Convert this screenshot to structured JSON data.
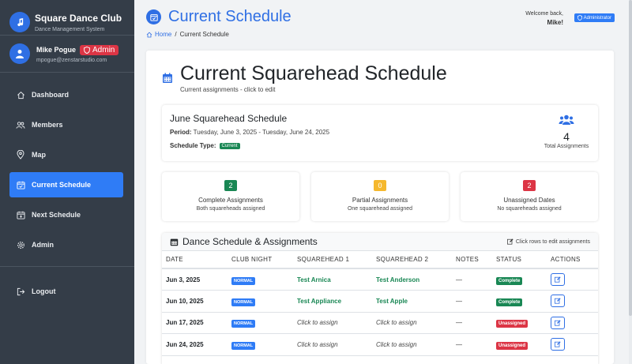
{
  "app": {
    "title": "Square Dance Club",
    "subtitle": "Dance Management System"
  },
  "user": {
    "name": "Mike Pogue",
    "badge": "Admin",
    "email": "mpogue@zenstarstudio.com"
  },
  "nav": {
    "dashboard": "Dashboard",
    "members": "Members",
    "map": "Map",
    "current_schedule": "Current Schedule",
    "next_schedule": "Next Schedule",
    "admin": "Admin",
    "logout": "Logout"
  },
  "header": {
    "title": "Current Schedule",
    "breadcrumb_home": "Home",
    "breadcrumb_sep": "/",
    "breadcrumb_current": "Current Schedule",
    "welcome": "Welcome back,",
    "welcome_name": "Mike!",
    "role": "Administrator"
  },
  "main": {
    "title": "Current Squarehead Schedule",
    "subtitle": "Current assignments - click to edit"
  },
  "schedule": {
    "name": "June Squarehead Schedule",
    "period_label": "Period:",
    "period_value": "Tuesday, June 3, 2025 - Tuesday, June 24, 2025",
    "type_label": "Schedule Type:",
    "type_value": "Current",
    "total_count": "4",
    "total_label": "Total Assignments"
  },
  "stats": {
    "complete": {
      "count": "2",
      "title": "Complete Assignments",
      "desc": "Both squareheads assigned",
      "color": "#198754"
    },
    "partial": {
      "count": "0",
      "title": "Partial Assignments",
      "desc": "One squarehead assigned",
      "color": "#f5b82e"
    },
    "unassigned": {
      "count": "2",
      "title": "Unassigned Dates",
      "desc": "No squareheads assigned",
      "color": "#dc3545"
    }
  },
  "table": {
    "title": "Dance Schedule & Assignments",
    "hint": "Click rows to edit assignments",
    "columns": [
      "DATE",
      "CLUB NIGHT",
      "SQUAREHEAD 1",
      "SQUAREHEAD 2",
      "NOTES",
      "STATUS",
      "ACTIONS"
    ],
    "rows": [
      {
        "date": "Jun 3, 2025",
        "night": "NORMAL",
        "sq1": "Test Arnica",
        "sq2": "Test Anderson",
        "notes": "—",
        "status": "Complete"
      },
      {
        "date": "Jun 10, 2025",
        "night": "NORMAL",
        "sq1": "Test Appliance",
        "sq2": "Test Apple",
        "notes": "—",
        "status": "Complete"
      },
      {
        "date": "Jun 17, 2025",
        "night": "NORMAL",
        "sq1": "Click to assign",
        "sq2": "Click to assign",
        "notes": "—",
        "status": "Unassigned"
      },
      {
        "date": "Jun 24, 2025",
        "night": "NORMAL",
        "sq1": "Click to assign",
        "sq2": "Click to assign",
        "notes": "—",
        "status": "Unassigned"
      }
    ]
  },
  "colors": {
    "sidebar": "#343d48",
    "accent": "#2f6fe4",
    "success": "#198754",
    "danger": "#dc3545",
    "warning": "#f5b82e"
  }
}
